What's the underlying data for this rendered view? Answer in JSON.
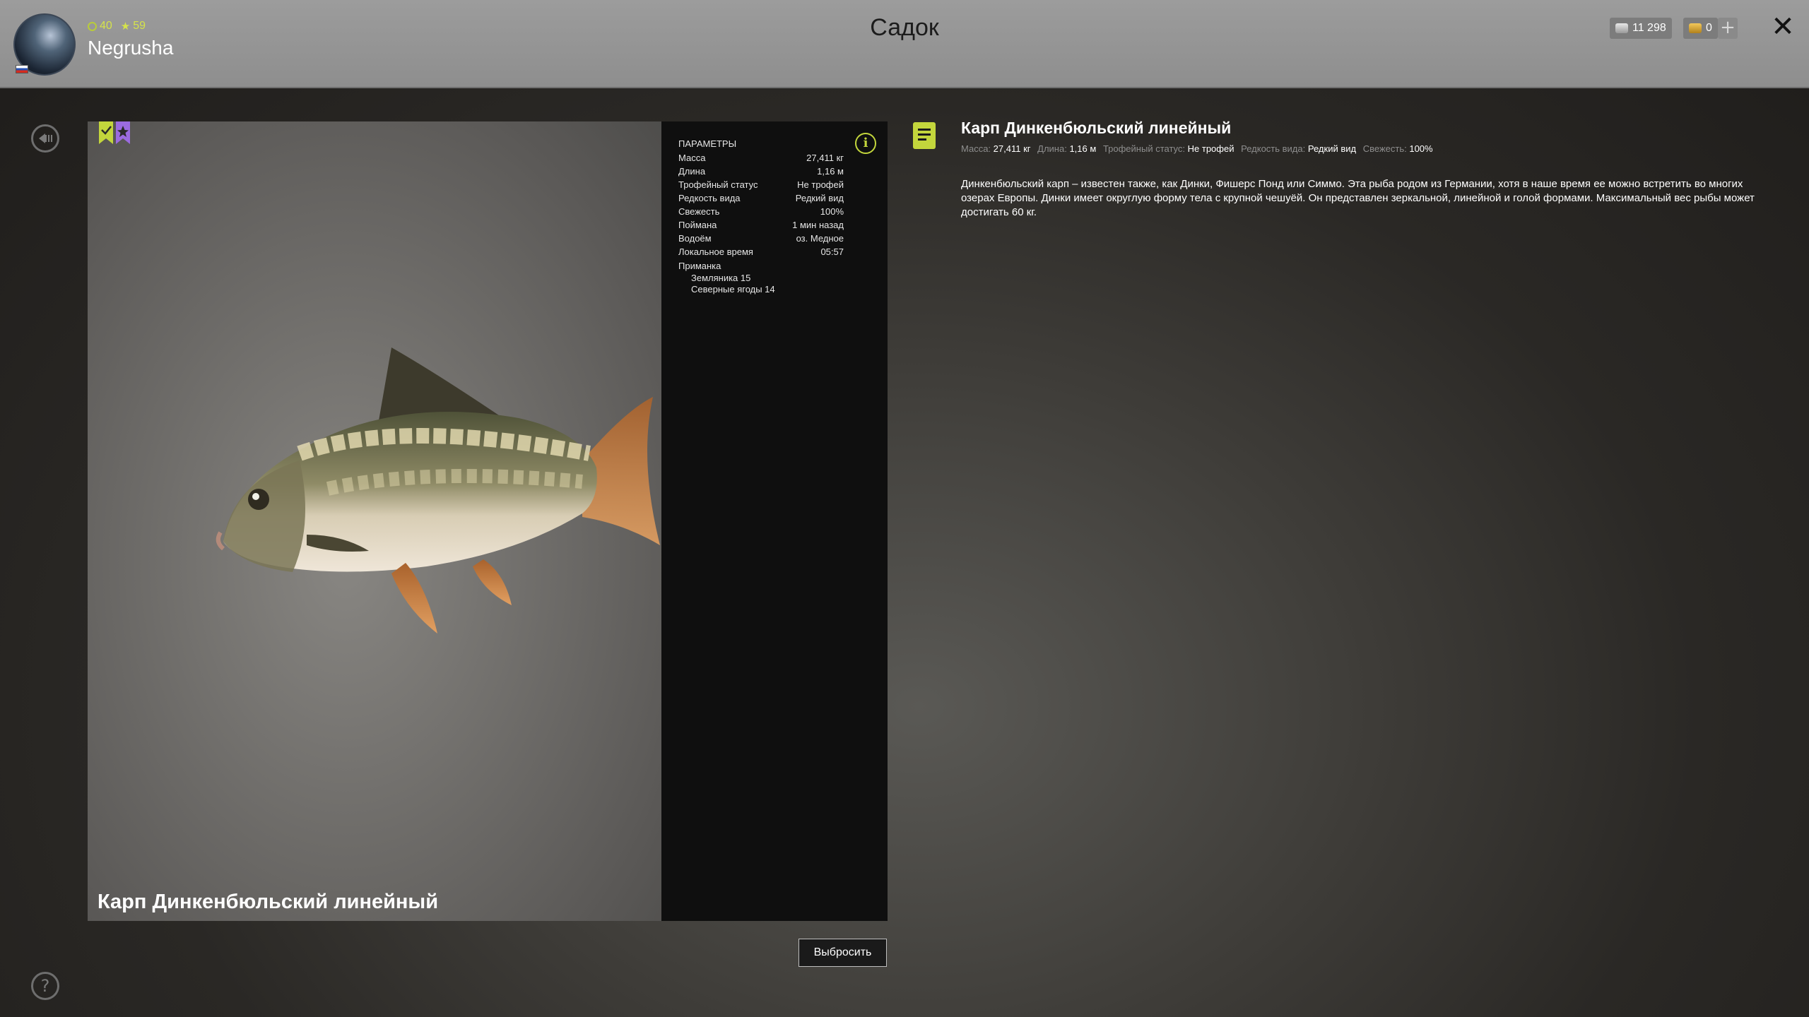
{
  "header": {
    "title": "Садок",
    "player": {
      "name": "Negrusha",
      "level": "40",
      "rank": "59"
    },
    "currency": {
      "silver": "11 298",
      "gold": "0"
    },
    "plus_label": "+",
    "close_label": "✕"
  },
  "sidebar": {
    "help_label": "?"
  },
  "fish": {
    "name": "Карп Динкенбюльский линейный"
  },
  "params": {
    "heading": "ПАРАМЕТРЫ",
    "rows": [
      {
        "label": "Масса",
        "value": "27,411 кг"
      },
      {
        "label": "Длина",
        "value": "1,16 м"
      },
      {
        "label": "Трофейный статус",
        "value": "Не трофей"
      },
      {
        "label": "Редкость вида",
        "value": "Редкий вид"
      },
      {
        "label": "Свежесть",
        "value": "100%"
      },
      {
        "label": "Поймана",
        "value": "1 мин назад"
      },
      {
        "label": "Водоём",
        "value": "оз. Медное"
      },
      {
        "label": "Локальное время",
        "value": "05:57"
      }
    ],
    "bait_heading": "Приманка",
    "baits": [
      "Земляника 15",
      "Северные ягоды 14"
    ]
  },
  "actions": {
    "discard_label": "Выбросить"
  },
  "description": {
    "title": "Карп Динкенбюльский линейный",
    "meta": [
      {
        "label": "Масса:",
        "value": "27,411 кг"
      },
      {
        "label": "Длина:",
        "value": "1,16 м"
      },
      {
        "label": "Трофейный статус:",
        "value": "Не трофей"
      },
      {
        "label": "Редкость вида:",
        "value": "Редкий вид"
      },
      {
        "label": "Свежесть:",
        "value": "100%"
      }
    ],
    "text": "Динкенбюльский карп – известен также, как Динки, Фишерс Понд или Симмо. Эта рыба родом из Германии, хотя в наше время ее можно встретить во многих озерах Европы. Динки имеет округлую форму тела с крупной чешуёй. Он представлен зеркальной, линейной и голой формами. Максимальный вес рыбы может достигать 60 кг."
  },
  "colors": {
    "accent": "#c3d63c",
    "bookmark_purple": "#9b6be0"
  }
}
